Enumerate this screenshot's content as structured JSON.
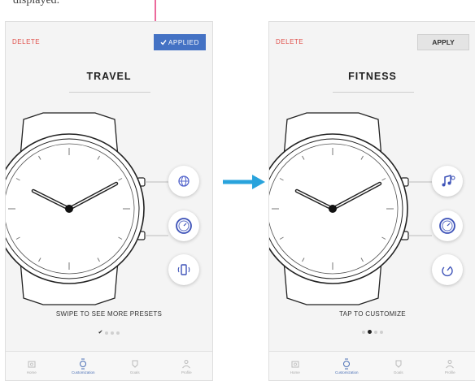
{
  "caption": "displayed.",
  "colors": {
    "accent_blue": "#4472c4",
    "delete_red": "#e0524d",
    "annotation_pink": "#e6397a",
    "flow_arrow": "#29a3dc"
  },
  "screens": [
    {
      "delete_label": "DELETE",
      "action_label": "APPLIED",
      "action_state": "applied",
      "action_icon": "check-icon",
      "title": "TRAVEL",
      "hint": "SWIPE TO SEE MORE PRESETS",
      "complications": [
        "globe-icon",
        "dial-icon",
        "phone-vibrate-icon"
      ],
      "pager": {
        "count": 4,
        "current": 1,
        "first_is_check": true
      },
      "tabs": [
        {
          "label": "Home",
          "icon": "home-icon"
        },
        {
          "label": "Customization",
          "icon": "watch-icon",
          "active": true
        },
        {
          "label": "Goals",
          "icon": "goal-icon"
        },
        {
          "label": "Profile",
          "icon": "profile-icon"
        }
      ]
    },
    {
      "delete_label": "DELETE",
      "action_label": "APPLY",
      "action_state": "apply",
      "title": "FITNESS",
      "hint": "TAP TO CUSTOMIZE",
      "complications": [
        "music-icon",
        "dial-icon",
        "activity-icon"
      ],
      "pager": {
        "count": 4,
        "current": 2,
        "first_is_check": false
      },
      "tabs": [
        {
          "label": "Home",
          "icon": "home-icon"
        },
        {
          "label": "Customization",
          "icon": "watch-icon",
          "active": true
        },
        {
          "label": "Goals",
          "icon": "goal-icon"
        },
        {
          "label": "Profile",
          "icon": "profile-icon"
        }
      ]
    }
  ]
}
